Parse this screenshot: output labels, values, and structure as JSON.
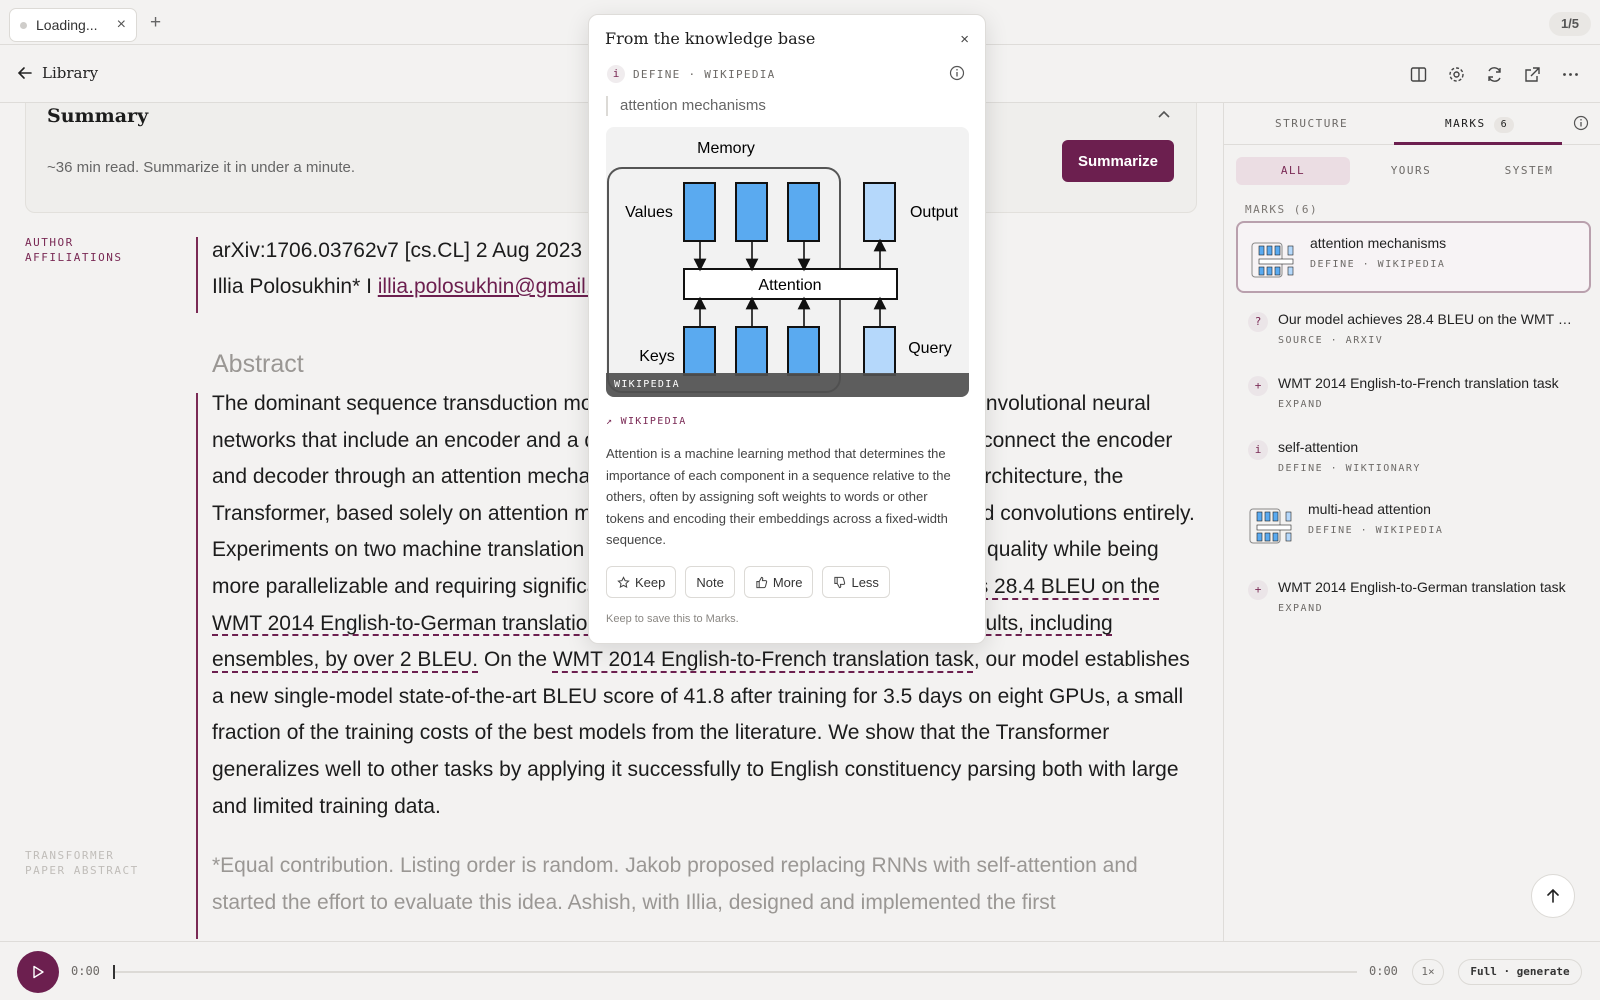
{
  "tab": {
    "title": "Loading...",
    "close": "×",
    "new": "+",
    "counter": "1/5"
  },
  "toolbar": {
    "back_label": "Library",
    "icons": [
      "panel-icon",
      "gear-icon",
      "refresh-icon",
      "external-link-icon",
      "more-icon"
    ]
  },
  "summary": {
    "heading": "Summary",
    "text": "~36 min read. Summarize it in under a minute.",
    "button": "Summarize"
  },
  "side_labels": {
    "author": "AUTHOR AFFILIATIONS",
    "transformer": "TRANSFORMER PAPER ABSTRACT"
  },
  "meta": {
    "line1": "arXiv:1706.03762v7 [cs.CL] 2 Aug 2023",
    "line2_name": "Illia Polosukhin* I ",
    "line2_email": "illia.polosukhin@gmail.com"
  },
  "abstract": {
    "heading": "Abstract",
    "p1": "The dominant sequence transduction models are based on complex recurrent or convolutional neural networks that include an encoder and a decoder. The best performing models also connect the encoder and decoder through an attention mechanism. We propose a new simple network architecture, the Transformer, based solely on attention mechanisms, dispensing with recurrence and convolutions entirely. Experiments on two machine translation tasks show these models to be superior in quality while being more parallelizable and requiring significantly less time to train. ",
    "u1": "Our model achieves 28.4 BLEU on the WMT 2014 English-to-German translation task, improving over the existing best results, including ensembles, by over 2 BLEU.",
    "p2": " On the ",
    "u2": "WMT 2014 English-to-French translation task",
    "p3": ", our model establishes a new single-model state-of-the-art BLEU score of 41.8 after training for 3.5 days on eight GPUs, a small fraction of the training costs of the best models from the literature. We show that the Transformer generalizes well to other tasks by applying it successfully to English constituency parsing both with large and limited training data.",
    "footnote": "*Equal contribution. Listing order is random. Jakob proposed replacing RNNs with self-attention and started the effort to evaluate this idea. Ashish, with Illia, designed and implemented the first"
  },
  "right_panel": {
    "tabs": {
      "structure": "STRUCTURE",
      "marks": "MARKS",
      "marks_count": "6"
    },
    "filters": [
      "ALL",
      "YOURS",
      "SYSTEM"
    ],
    "marks_label": "MARKS (6)",
    "marks": [
      {
        "title": "attention mechanisms",
        "sub": "DEFINE · WIKIPEDIA",
        "badge": "",
        "thumb": true
      },
      {
        "title": "Our model achieves 28.4 BLEU on the WMT 2014 English-to-German translation task",
        "sub": "SOURCE · ARXIV",
        "badge": "?",
        "thumb": false
      },
      {
        "title": "WMT 2014 English-to-French translation task",
        "sub": "EXPAND",
        "badge": "+",
        "thumb": false
      },
      {
        "title": "self-attention",
        "sub": "DEFINE · WIKTIONARY",
        "badge": "i",
        "thumb": false
      },
      {
        "title": "multi-head attention",
        "sub": "DEFINE · WIKIPEDIA",
        "badge": "",
        "thumb": true
      },
      {
        "title": "WMT 2014 English-to-German translation task",
        "sub": "EXPAND",
        "badge": "+",
        "thumb": false
      }
    ]
  },
  "player": {
    "time_start": "0:00",
    "time_end": "0:00",
    "speed": "1×",
    "mode": "Full · generate",
    "progress": 0
  },
  "popover": {
    "header": "From the knowledge base",
    "close": "×",
    "tag_icon": "i",
    "tag": "DEFINE · WIKIPEDIA",
    "query": "attention mechanisms",
    "figure": {
      "memory": "Memory",
      "values": "Values",
      "output": "Output",
      "attention": "Attention",
      "keys": "Keys",
      "query": "Query",
      "label": "WIKIPEDIA"
    },
    "source": "↗ WIKIPEDIA",
    "description": "Attention is a machine learning method that determines the importance of each component in a sequence relative to the others, often by assigning soft weights to words or other tokens and encoding their embeddings across a fixed-width sequence.",
    "actions": {
      "keep": "Keep",
      "note": "Note",
      "more": "More",
      "less": "Less"
    },
    "footer": "Keep to save this to Marks."
  }
}
